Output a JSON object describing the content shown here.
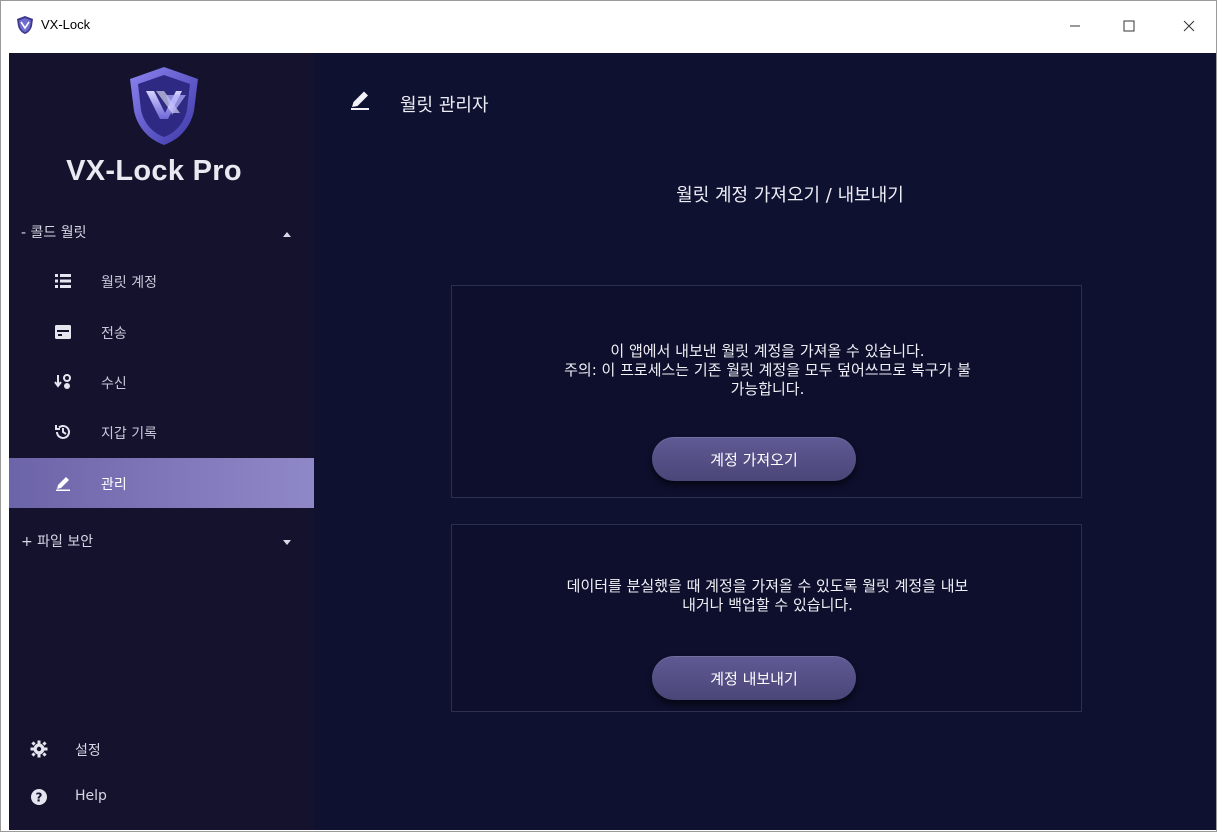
{
  "window": {
    "title": "VX-Lock"
  },
  "sidebar": {
    "brand": "VX-Lock Pro",
    "group_cold_wallet": {
      "label": "- 콜드 월릿"
    },
    "items": [
      {
        "label": "월릿 계정",
        "icon": "list-icon"
      },
      {
        "label": "전송",
        "icon": "send-icon"
      },
      {
        "label": "수신",
        "icon": "receive-icon"
      },
      {
        "label": "지갑 기록",
        "icon": "history-icon"
      },
      {
        "label": "관리",
        "icon": "pen-icon",
        "active": true
      }
    ],
    "group_file_security": {
      "label": "+ 파일 보안"
    },
    "bottom": [
      {
        "label": "설정",
        "icon": "gear-icon"
      },
      {
        "label": "Help",
        "icon": "help-icon"
      }
    ]
  },
  "main": {
    "page_title": "월릿 관리자",
    "section_title": "월릿 계정 가져오기 / 내보내기",
    "import_card": {
      "line1": "이 앱에서 내보낸 월릿 계정을 가져올 수 있습니다.",
      "line2": "주의: 이 프로세스는 기존 월릿 계정을 모두 덮어쓰므로 복구가 불",
      "line3": "가능합니다.",
      "button": "계정 가져오기"
    },
    "export_card": {
      "line1": "데이터를 분실했을 때 계정을 가져올 수 있도록 월릿 계정을 내보",
      "line2": "내거나 백업할 수 있습니다.",
      "button": "계정 내보내기"
    }
  },
  "colors": {
    "sidebar_bg": "#14122c",
    "main_bg": "#0f1130",
    "active_item": "#8f88c8",
    "button_bg": "#5f5a94"
  }
}
